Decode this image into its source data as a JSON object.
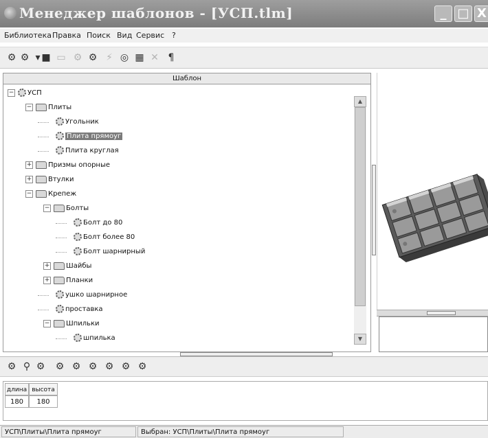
{
  "window": {
    "title": "Менеджер шаблонов - [УСП.tlm]",
    "min_icon": "minimize-icon",
    "max_icon": "maximize-icon",
    "close_icon": "close-icon",
    "min_glyph": "_",
    "max_glyph": "□",
    "close_glyph": "X"
  },
  "menu": [
    "Библиотека",
    "Правка",
    "Поиск",
    "Вид",
    "Сервис",
    "?"
  ],
  "toolbar": {
    "buttons": [
      {
        "icon": "library-icon",
        "glyph": "⚙",
        "enabled": true
      },
      {
        "icon": "library-dropdown-icon",
        "glyph": "⚙",
        "enabled": true
      },
      {
        "icon": "dropdown-arrow-icon",
        "glyph": "▾",
        "enabled": true
      },
      {
        "icon": "save-icon",
        "glyph": "■",
        "enabled": true
      },
      {
        "icon": "folder-icon",
        "glyph": "▭",
        "enabled": false
      },
      {
        "icon": "gear-icon",
        "glyph": "⚙",
        "enabled": false
      },
      {
        "icon": "gear-add-icon",
        "glyph": "⚙",
        "enabled": true
      },
      {
        "icon": "lightning-icon",
        "glyph": "⚡",
        "enabled": false
      },
      {
        "icon": "target-icon",
        "glyph": "◎",
        "enabled": true
      },
      {
        "icon": "grid-icon",
        "glyph": "▦",
        "enabled": true
      },
      {
        "icon": "delete-icon",
        "glyph": "✕",
        "enabled": false
      },
      {
        "icon": "properties-icon",
        "glyph": "¶",
        "enabled": true
      }
    ]
  },
  "tree": {
    "header": "Шаблон",
    "items": [
      {
        "label": "УСП",
        "level": 0,
        "kind": "root",
        "expander": "−"
      },
      {
        "label": "Плиты",
        "level": 1,
        "kind": "folder-open",
        "expander": "−"
      },
      {
        "label": "Угольник",
        "level": 2,
        "kind": "item"
      },
      {
        "label": "Плита прямоуг",
        "level": 2,
        "kind": "item",
        "selected": true
      },
      {
        "label": "Плита круглая",
        "level": 2,
        "kind": "item"
      },
      {
        "label": "Призмы опорные",
        "level": 1,
        "kind": "folder",
        "expander": "+"
      },
      {
        "label": "Втулки",
        "level": 1,
        "kind": "folder",
        "expander": "+"
      },
      {
        "label": "Крепеж",
        "level": 1,
        "kind": "folder-open",
        "expander": "−"
      },
      {
        "label": "Болты",
        "level": 2,
        "kind": "folder-open",
        "expander": "−"
      },
      {
        "label": "Болт до 80",
        "level": 3,
        "kind": "item"
      },
      {
        "label": "Болт более 80",
        "level": 3,
        "kind": "item"
      },
      {
        "label": "Болт шарнирный",
        "level": 3,
        "kind": "item"
      },
      {
        "label": "Шайбы",
        "level": 2,
        "kind": "folder",
        "expander": "+"
      },
      {
        "label": "Планки",
        "level": 2,
        "kind": "folder",
        "expander": "+"
      },
      {
        "label": "ушко шарнирное",
        "level": 2,
        "kind": "item"
      },
      {
        "label": "проставка",
        "level": 2,
        "kind": "item"
      },
      {
        "label": "Шпильки",
        "level": 2,
        "kind": "folder-open",
        "expander": "−"
      },
      {
        "label": "шпилька",
        "level": 3,
        "kind": "item"
      }
    ]
  },
  "scroll": {
    "up_glyph": "▲",
    "down_glyph": "▼"
  },
  "bottom_toolbar": {
    "buttons": [
      {
        "icon": "tool-icon",
        "glyph": "⚙"
      },
      {
        "icon": "zoom-icon",
        "glyph": "⚲"
      },
      {
        "icon": "gear-dropdown-icon",
        "glyph": "⚙"
      },
      {
        "icon": "component-icon",
        "glyph": "⚙"
      },
      {
        "icon": "component-list-1-icon",
        "glyph": "⚙"
      },
      {
        "icon": "component-list-2-icon",
        "glyph": "⚙"
      },
      {
        "icon": "component-list-3-icon",
        "glyph": "⚙"
      },
      {
        "icon": "component-list-4-icon",
        "glyph": "⚙"
      },
      {
        "icon": "component-list-5-icon",
        "glyph": "⚙"
      }
    ]
  },
  "params": {
    "headers": [
      "длина",
      "высота"
    ],
    "values": [
      "180",
      "180"
    ]
  },
  "status": {
    "path": "УСП\\Плиты\\Плита прямоуг",
    "selected": "Выбран: УСП\\Плиты\\Плита прямоуг"
  }
}
